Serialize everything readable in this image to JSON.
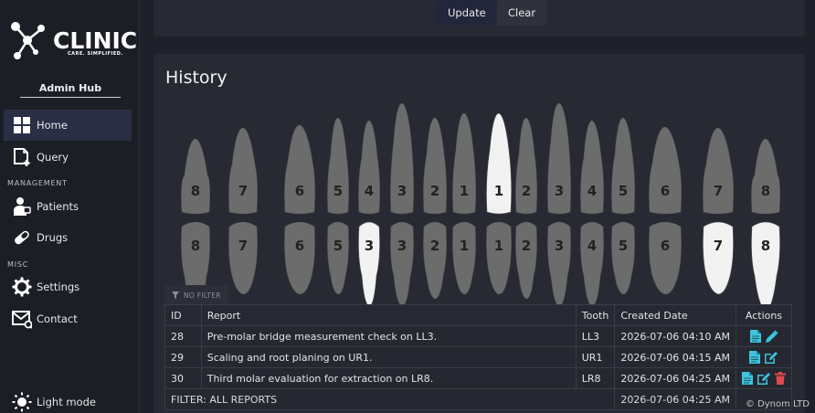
{
  "app": {
    "logo_text": "CLINIC",
    "logo_tagline": "CARE. SIMPLIFIED.",
    "hub_title": "Admin Hub"
  },
  "sidebar": {
    "items": [
      {
        "label": "Home",
        "icon": "home-icon",
        "active": true
      },
      {
        "label": "Query",
        "icon": "query-icon"
      },
      {
        "section": "MANAGEMENT"
      },
      {
        "label": "Patients",
        "icon": "patients-icon"
      },
      {
        "label": "Drugs",
        "icon": "pill-icon"
      },
      {
        "section": "MISC"
      },
      {
        "label": "Settings",
        "icon": "gear-icon"
      },
      {
        "label": "Contact",
        "icon": "mail-icon"
      }
    ],
    "theme_toggle": "Light mode"
  },
  "top_panel": {
    "update_label": "Update",
    "clear_label": "Clear"
  },
  "history": {
    "title": "History",
    "upper_labels": [
      "8",
      "7",
      "6",
      "5",
      "4",
      "3",
      "2",
      "1",
      "1",
      "2",
      "3",
      "4",
      "5",
      "6",
      "7",
      "8"
    ],
    "lower_labels": [
      "8",
      "7",
      "6",
      "5",
      "3",
      "3",
      "2",
      "1",
      "1",
      "2",
      "3",
      "4",
      "5",
      "6",
      "7",
      "8"
    ],
    "highlighted": {
      "upper": [
        8
      ],
      "lower": [
        4,
        14,
        15
      ]
    },
    "filter_tag": "NO FILTER",
    "table": {
      "headers": [
        "ID",
        "Report",
        "Tooth",
        "Created Date",
        "Actions"
      ],
      "rows": [
        {
          "id": "28",
          "report": "Pre-molar bridge measurement check on LL3.",
          "tooth": "LL3",
          "date": "2026-07-06 04:10 AM",
          "actions": [
            "view",
            "edit"
          ]
        },
        {
          "id": "29",
          "report": "Scaling and root planing on UR1.",
          "tooth": "UR1",
          "date": "2026-07-06 04:15 AM",
          "actions": [
            "view",
            "edit"
          ]
        },
        {
          "id": "30",
          "report": "Third molar evaluation for extraction on LR8.",
          "tooth": "LR8",
          "date": "2026-07-06 04:25 AM",
          "actions": [
            "view",
            "edit",
            "delete"
          ]
        }
      ],
      "footer_filter": "FILTER: ALL REPORTS",
      "footer_date": "2026-07-06 04:25 AM"
    }
  },
  "credit": "© Dynom LTD",
  "colors": {
    "accent": "#3ec4dc",
    "danger": "#e0484f",
    "tooth_grey": "#6c6c6c",
    "tooth_white": "#f2f2f2"
  }
}
